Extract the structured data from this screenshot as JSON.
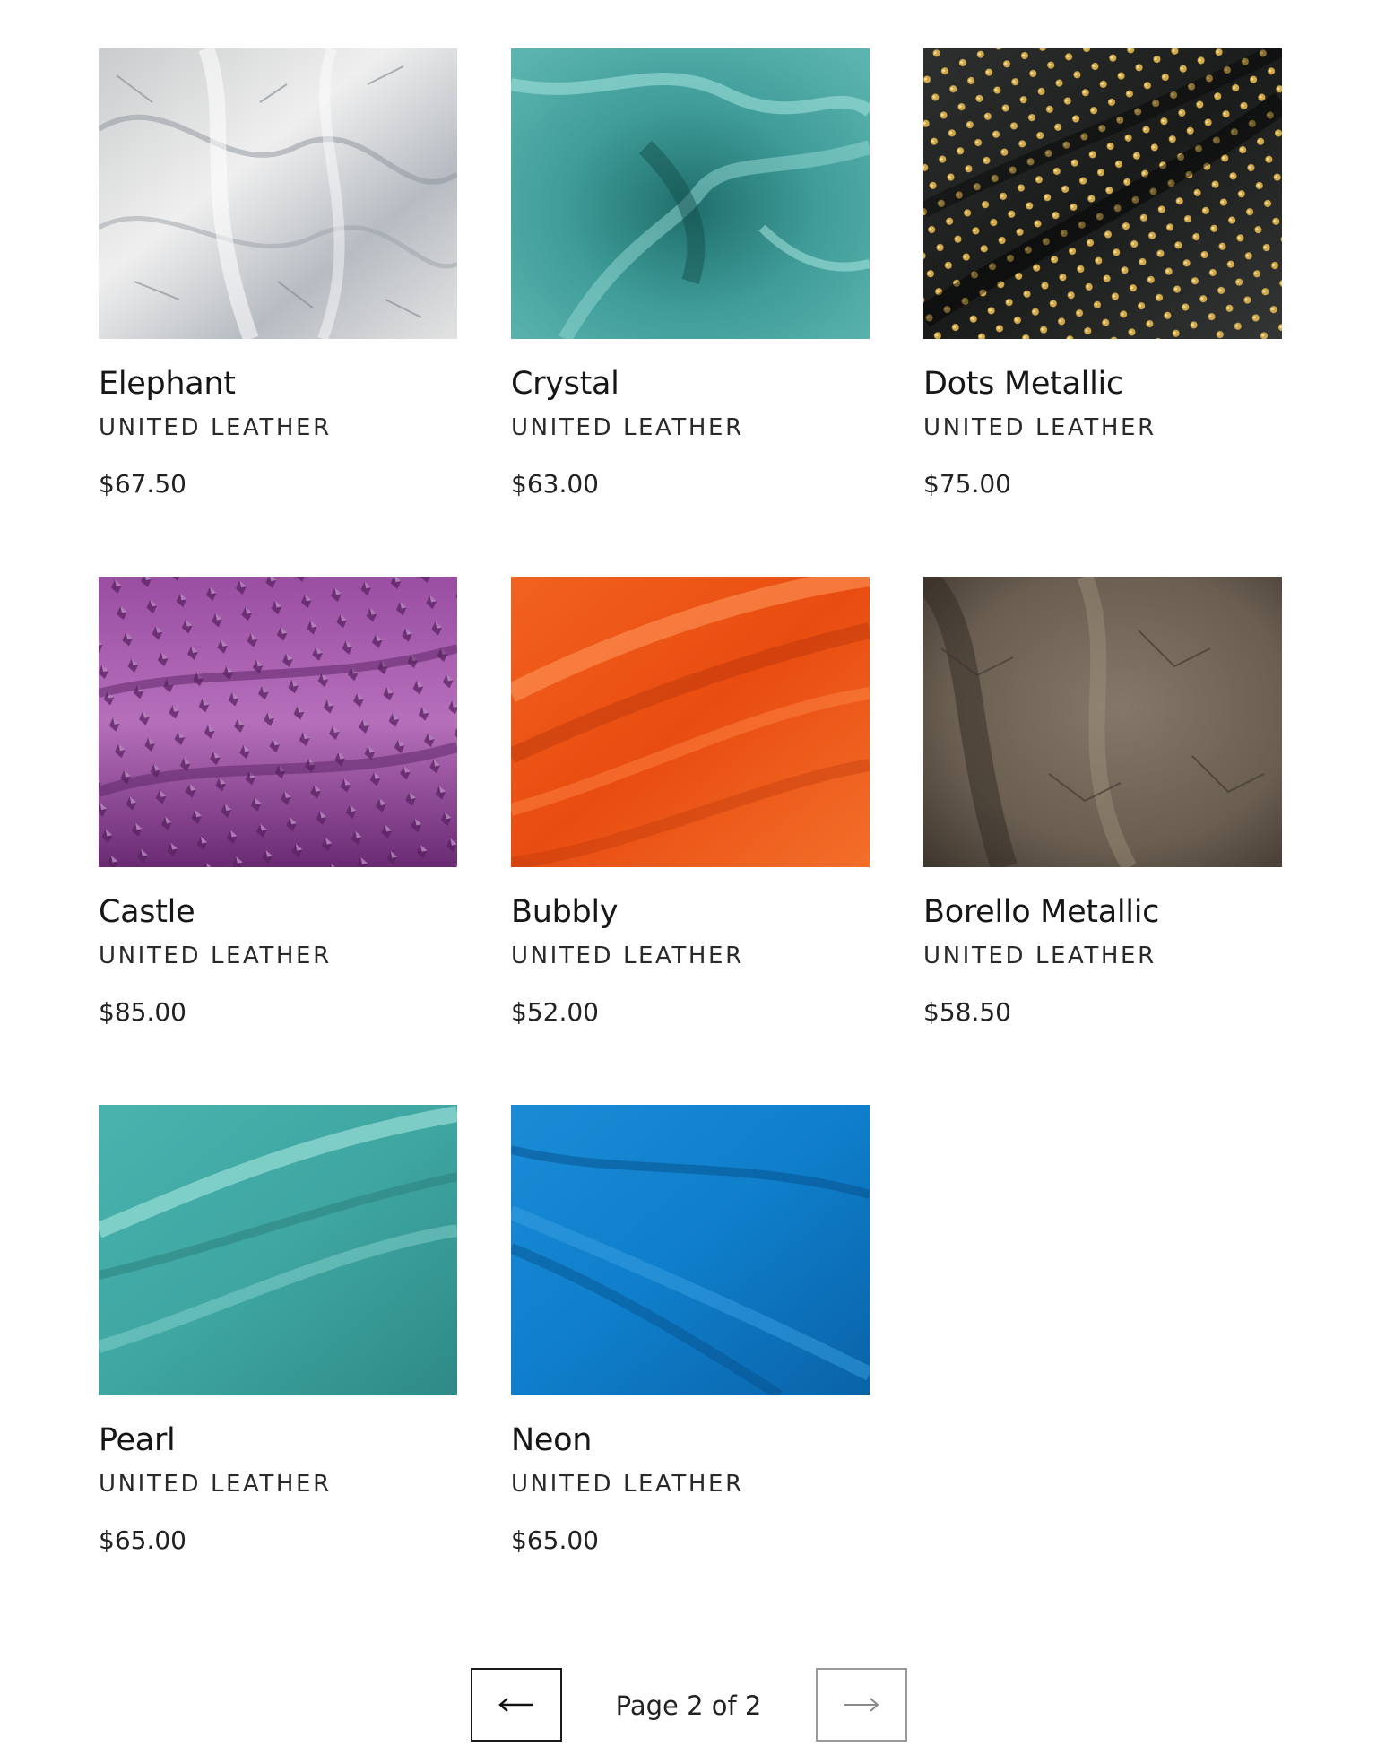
{
  "products": [
    {
      "title": "Elephant",
      "vendor": "UNITED LEATHER",
      "price": "$67.50",
      "swatch": "elephant",
      "colors": [
        "#d7d7d7",
        "#f1f1f1",
        "#9ca3ab"
      ]
    },
    {
      "title": "Crystal",
      "vendor": "UNITED LEATHER",
      "price": "$63.00",
      "swatch": "crystal",
      "colors": [
        "#3f9c98",
        "#7fcac5",
        "#1f6e6b"
      ]
    },
    {
      "title": "Dots Metallic",
      "vendor": "UNITED LEATHER",
      "price": "$75.00",
      "swatch": "dots",
      "colors": [
        "#1c1e1d",
        "#d1a94c",
        "#3a3c3a"
      ]
    },
    {
      "title": "Castle",
      "vendor": "UNITED LEATHER",
      "price": "$85.00",
      "swatch": "castle",
      "colors": [
        "#8a3f92",
        "#b56fbb",
        "#5a2163"
      ]
    },
    {
      "title": "Bubbly",
      "vendor": "UNITED LEATHER",
      "price": "$52.00",
      "swatch": "bubbly",
      "colors": [
        "#ee5316",
        "#ff8a4a",
        "#b8360b"
      ]
    },
    {
      "title": "Borello Metallic",
      "vendor": "UNITED LEATHER",
      "price": "$58.50",
      "swatch": "borello",
      "colors": [
        "#6a5e51",
        "#9a8c7c",
        "#3a322a"
      ]
    },
    {
      "title": "Pearl",
      "vendor": "UNITED LEATHER",
      "price": "$65.00",
      "swatch": "pearl",
      "colors": [
        "#3fa6a2",
        "#8fd8d2",
        "#2a7d7a"
      ]
    },
    {
      "title": "Neon",
      "vendor": "UNITED LEATHER",
      "price": "$65.00",
      "swatch": "neon",
      "colors": [
        "#0f7ecb",
        "#3aa0e2",
        "#064f8a"
      ]
    }
  ],
  "pagination": {
    "label": "Page 2 of 2",
    "prev_icon": "arrow-left-icon",
    "next_icon": "arrow-right-icon"
  }
}
